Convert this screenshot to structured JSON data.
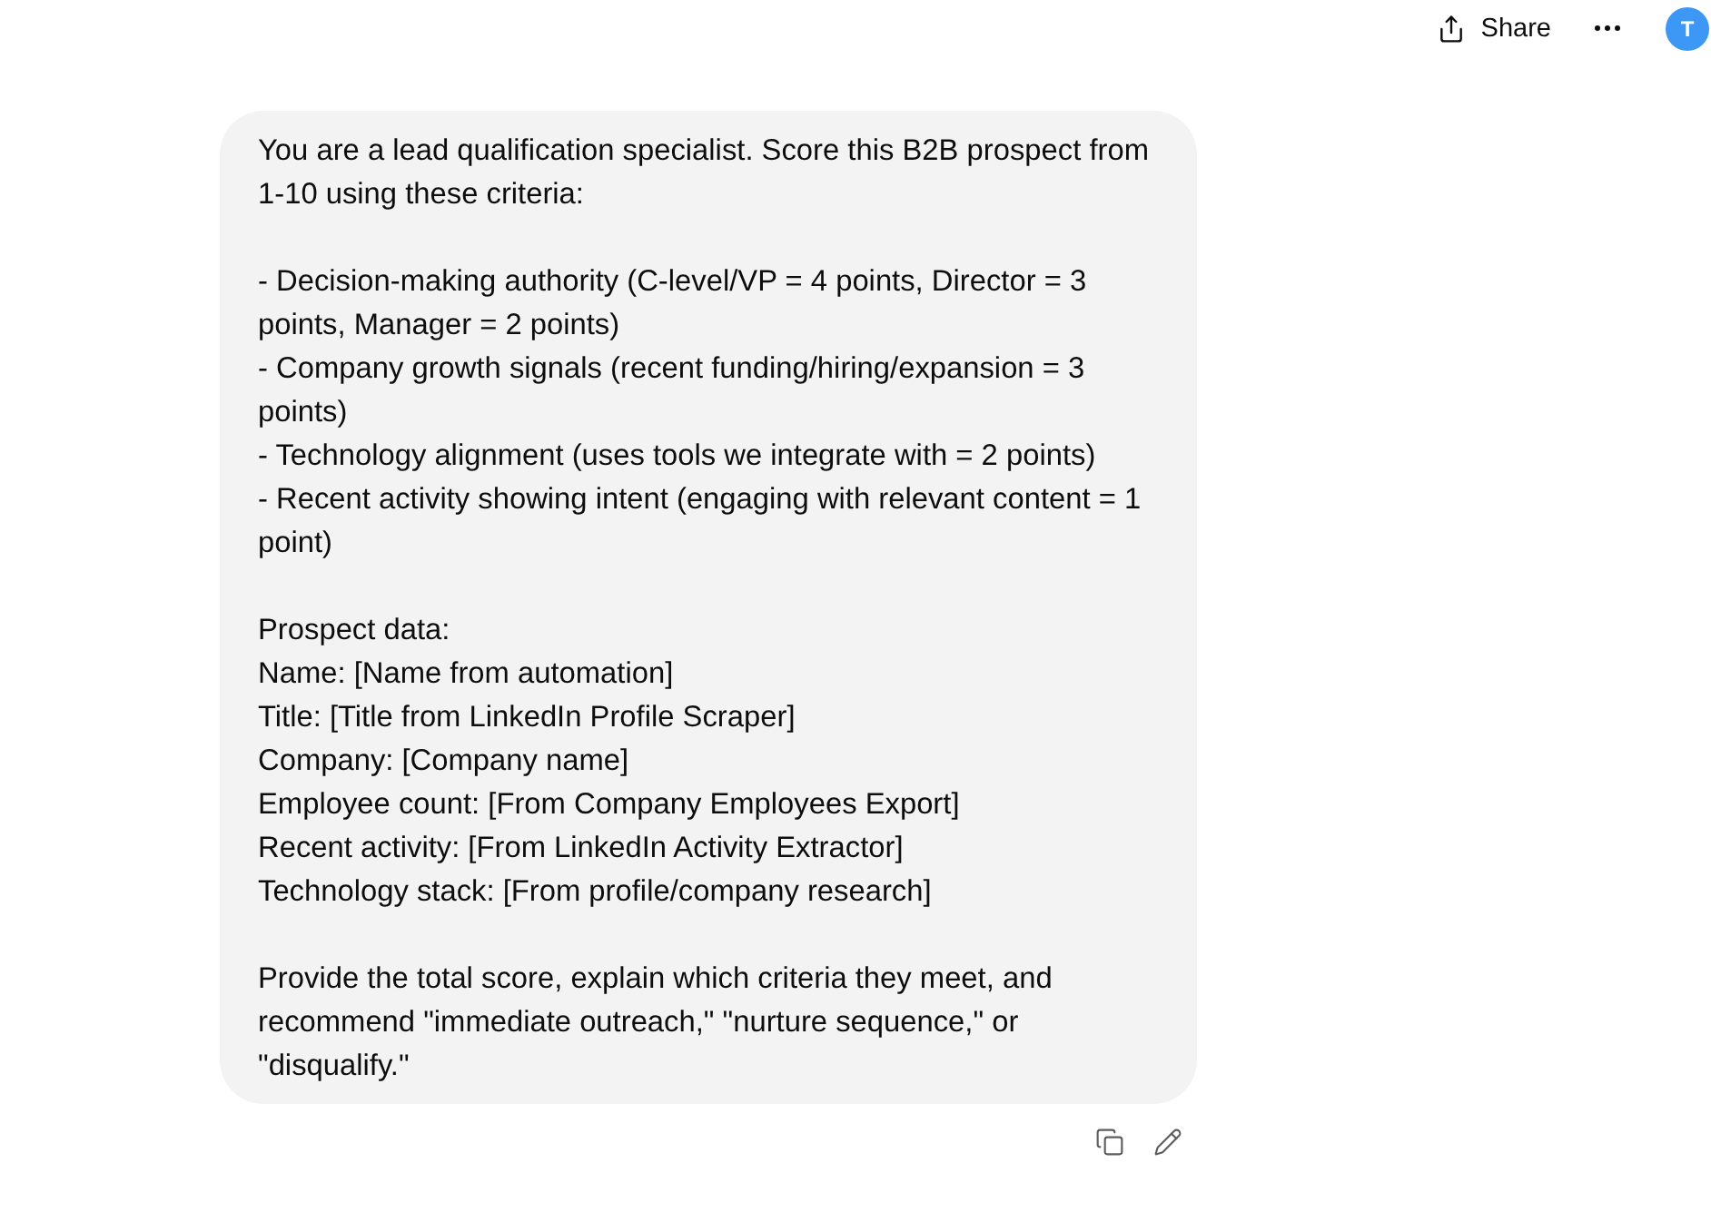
{
  "header": {
    "share_label": "Share",
    "avatar_initial": "T"
  },
  "message": {
    "paragraphs": [
      [
        "You are a lead qualification specialist. Score this B2B prospect from 1-10 using these criteria:"
      ],
      [
        "- Decision-making authority (C-level/VP = 4 points, Director = 3 points, Manager = 2 points)",
        "- Company growth signals (recent funding/hiring/expansion = 3 points)",
        "- Technology alignment (uses tools we integrate with = 2 points)",
        "- Recent activity showing intent (engaging with relevant content = 1 point)"
      ],
      [
        "Prospect data:",
        "Name: [Name from automation]",
        "Title: [Title from LinkedIn Profile Scraper]",
        "Company: [Company name]",
        "Employee count: [From Company Employees Export]",
        "Recent activity: [From LinkedIn Activity Extractor]",
        "Technology stack: [From profile/company research]"
      ],
      [
        "Provide the total score, explain which criteria they meet, and recommend \"immediate outreach,\" \"nurture sequence,\" or \"disqualify.\""
      ]
    ]
  }
}
